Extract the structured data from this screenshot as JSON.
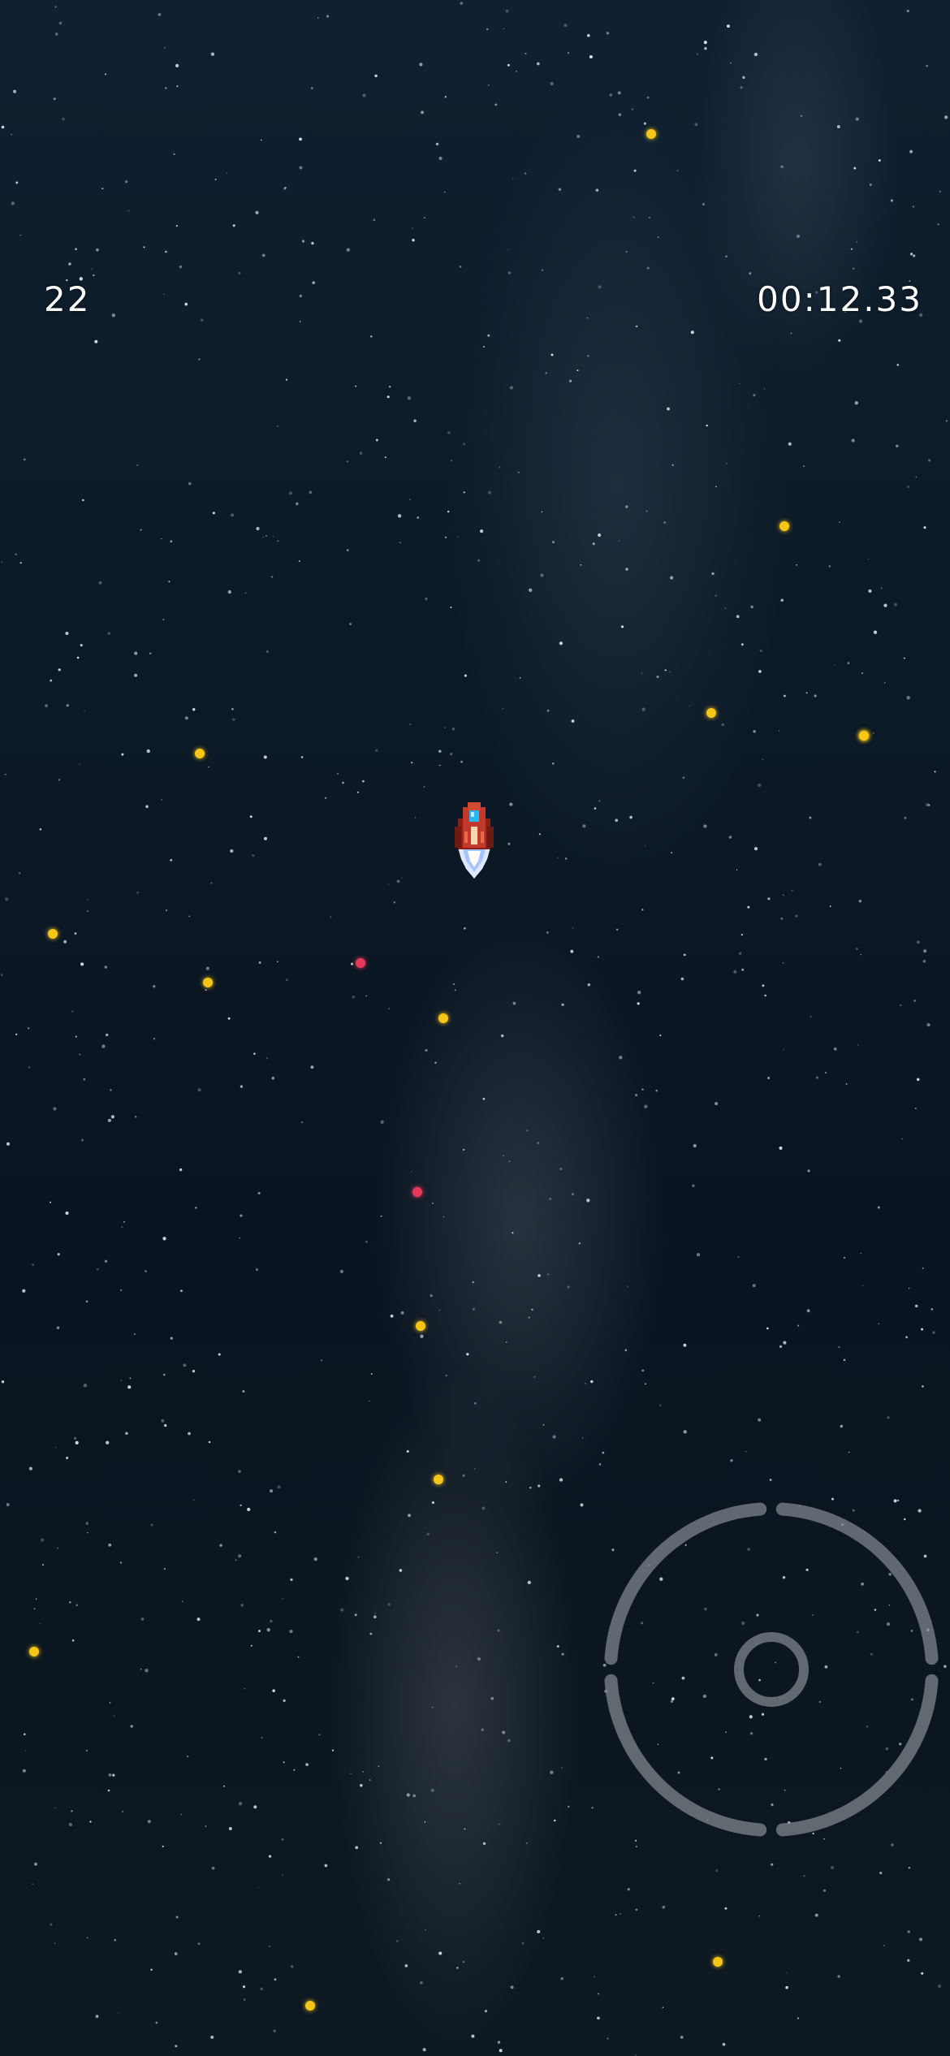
{
  "hud": {
    "score": "22",
    "timer": "00:12.33"
  },
  "colors": {
    "coin": "#f5c518",
    "enemy_bullet": "#e8385a",
    "joystick": "#7e858c",
    "ship_body": "#c0392b",
    "ship_window": "#29b6f6",
    "thruster": "#dfe9ff"
  },
  "pickups": [
    {
      "kind": "coin"
    },
    {
      "kind": "coin"
    },
    {
      "kind": "coin"
    },
    {
      "kind": "coin"
    },
    {
      "kind": "coin"
    },
    {
      "kind": "coin"
    },
    {
      "kind": "coin"
    },
    {
      "kind": "enemy_bullet"
    },
    {
      "kind": "coin"
    },
    {
      "kind": "coin"
    },
    {
      "kind": "enemy_bullet"
    },
    {
      "kind": "coin"
    },
    {
      "kind": "coin"
    },
    {
      "kind": "coin"
    },
    {
      "kind": "coin"
    },
    {
      "kind": "coin"
    }
  ],
  "player": {
    "icon": "rocket-ship-icon"
  },
  "controls": {
    "icon": "virtual-joystick-icon"
  }
}
